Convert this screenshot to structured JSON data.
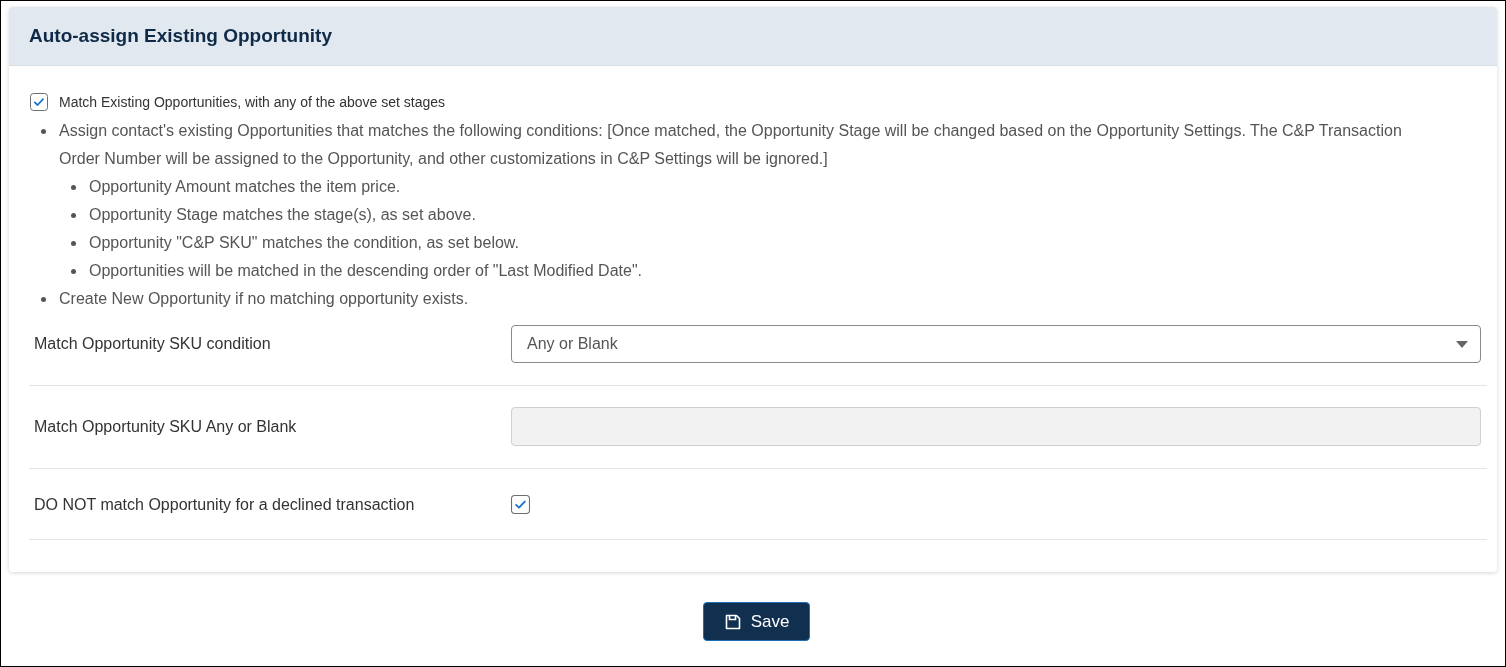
{
  "panel": {
    "title": "Auto-assign Existing Opportunity",
    "match_option": {
      "label": "Match Existing Opportunities, with any of the above set stages",
      "checked": true
    },
    "notes": [
      {
        "text": "Assign contact's existing Opportunities that matches the following conditions: [Once matched, the Opportunity Stage will be changed based on the Opportunity Settings. The C&P Transaction Order Number will be assigned to the Opportunity, and other customizations in C&P Settings will be ignored.]",
        "children": [
          {
            "text": "Opportunity Amount matches the item price."
          },
          {
            "text": "Opportunity Stage matches the stage(s), as set above."
          },
          {
            "text": "Opportunity \"C&P SKU\" matches the condition, as set below."
          },
          {
            "text": "Opportunities will be matched in the descending order of \"Last Modified Date\"."
          }
        ]
      },
      {
        "text": "Create New Opportunity if no matching opportunity exists."
      }
    ],
    "fields": [
      {
        "kind": "select",
        "label": "Match Opportunity SKU condition",
        "value": "Any or Blank"
      },
      {
        "kind": "text",
        "label": "Match Opportunity SKU Any or Blank",
        "disabled": true
      },
      {
        "kind": "checkbox",
        "label": "DO NOT match Opportunity for a declined transaction",
        "checked": true
      }
    ]
  },
  "save_button": {
    "label": "Save"
  }
}
